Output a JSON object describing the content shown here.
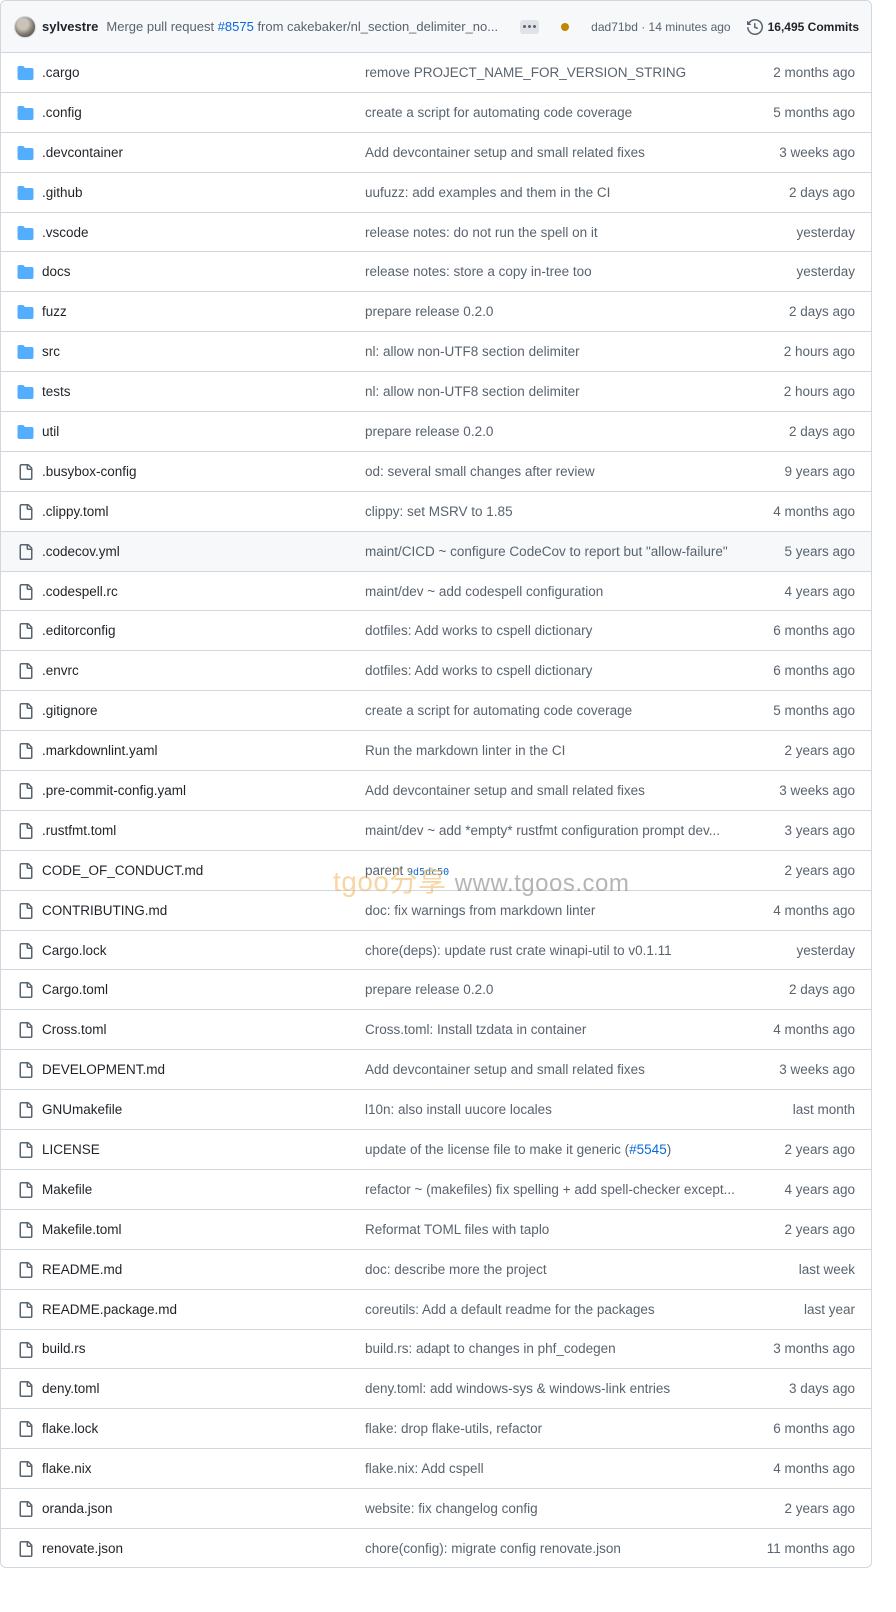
{
  "commit_bar": {
    "author": "sylvestre",
    "message_prefix": "Merge pull request ",
    "message_pr": "#8575",
    "message_suffix": " from cakebaker/nl_section_delimiter_no...",
    "sha_time": "dad71bd · 14 minutes ago",
    "commits": "16,495 Commits",
    "status_color": "#bf8700"
  },
  "files": [
    {
      "type": "folder",
      "name": ".cargo",
      "message": "remove PROJECT_NAME_FOR_VERSION_STRING",
      "date": "2 months ago"
    },
    {
      "type": "folder",
      "name": ".config",
      "message": "create a script for automating code coverage",
      "date": "5 months ago"
    },
    {
      "type": "folder",
      "name": ".devcontainer",
      "message": "Add devcontainer setup and small related fixes",
      "date": "3 weeks ago"
    },
    {
      "type": "folder",
      "name": ".github",
      "message": "uufuzz: add examples and them in the CI",
      "date": "2 days ago"
    },
    {
      "type": "folder",
      "name": ".vscode",
      "message": "release notes: do not run the spell on it",
      "date": "yesterday"
    },
    {
      "type": "folder",
      "name": "docs",
      "message": "release notes: store a copy in-tree too",
      "date": "yesterday"
    },
    {
      "type": "folder",
      "name": "fuzz",
      "message": "prepare release 0.2.0",
      "date": "2 days ago"
    },
    {
      "type": "folder",
      "name": "src",
      "message": "nl: allow non-UTF8 section delimiter",
      "date": "2 hours ago"
    },
    {
      "type": "folder",
      "name": "tests",
      "message": "nl: allow non-UTF8 section delimiter",
      "date": "2 hours ago"
    },
    {
      "type": "folder",
      "name": "util",
      "message": "prepare release 0.2.0",
      "date": "2 days ago"
    },
    {
      "type": "file",
      "name": ".busybox-config",
      "message": "od: several small changes after review",
      "date": "9 years ago"
    },
    {
      "type": "file",
      "name": ".clippy.toml",
      "message": "clippy: set MSRV to 1.85",
      "date": "4 months ago"
    },
    {
      "type": "file",
      "name": ".codecov.yml",
      "message": "maint/CICD ~ configure CodeCov to report but \"allow-failure\"",
      "date": "5 years ago",
      "highlight": true
    },
    {
      "type": "file",
      "name": ".codespell.rc",
      "message": "maint/dev ~ add codespell configuration",
      "date": "4 years ago"
    },
    {
      "type": "file",
      "name": ".editorconfig",
      "message": "dotfiles: Add works to cspell dictionary",
      "date": "6 months ago"
    },
    {
      "type": "file",
      "name": ".envrc",
      "message": "dotfiles: Add works to cspell dictionary",
      "date": "6 months ago"
    },
    {
      "type": "file",
      "name": ".gitignore",
      "message": "create a script for automating code coverage",
      "date": "5 months ago"
    },
    {
      "type": "file",
      "name": ".markdownlint.yaml",
      "message": "Run the markdown linter in the CI",
      "date": "2 years ago"
    },
    {
      "type": "file",
      "name": ".pre-commit-config.yaml",
      "message": "Add devcontainer setup and small related fixes",
      "date": "3 weeks ago"
    },
    {
      "type": "file",
      "name": ".rustfmt.toml",
      "message": "maint/dev ~ add *empty* rustfmt configuration prompt dev...",
      "date": "3 years ago"
    },
    {
      "type": "file",
      "name": "CODE_OF_CONDUCT.md",
      "message": "parent ",
      "message_sha": "9d5dc50",
      "date": "2 years ago"
    },
    {
      "type": "file",
      "name": "CONTRIBUTING.md",
      "message": "doc: fix warnings from markdown linter",
      "date": "4 months ago"
    },
    {
      "type": "file",
      "name": "Cargo.lock",
      "message": "chore(deps): update rust crate winapi-util to v0.1.11",
      "date": "yesterday"
    },
    {
      "type": "file",
      "name": "Cargo.toml",
      "message": "prepare release 0.2.0",
      "date": "2 days ago"
    },
    {
      "type": "file",
      "name": "Cross.toml",
      "message": "Cross.toml: Install tzdata in container",
      "date": "4 months ago"
    },
    {
      "type": "file",
      "name": "DEVELOPMENT.md",
      "message": "Add devcontainer setup and small related fixes",
      "date": "3 weeks ago"
    },
    {
      "type": "file",
      "name": "GNUmakefile",
      "message": "l10n: also install uucore locales",
      "date": "last month"
    },
    {
      "type": "file",
      "name": "LICENSE",
      "message": "update of the license file to make it generic (",
      "message_link": "#5545",
      "message_after": ")",
      "date": "2 years ago"
    },
    {
      "type": "file",
      "name": "Makefile",
      "message": "refactor ~ (makefiles) fix spelling + add spell-checker except...",
      "date": "4 years ago"
    },
    {
      "type": "file",
      "name": "Makefile.toml",
      "message": "Reformat TOML files with taplo",
      "date": "2 years ago"
    },
    {
      "type": "file",
      "name": "README.md",
      "message": "doc: describe more the project",
      "date": "last week"
    },
    {
      "type": "file",
      "name": "README.package.md",
      "message": "coreutils: Add a default readme for the packages",
      "date": "last year"
    },
    {
      "type": "file",
      "name": "build.rs",
      "message": "build.rs: adapt to changes in phf_codegen",
      "date": "3 months ago"
    },
    {
      "type": "file",
      "name": "deny.toml",
      "message": "deny.toml: add windows-sys & windows-link entries",
      "date": "3 days ago"
    },
    {
      "type": "file",
      "name": "flake.lock",
      "message": "flake: drop flake-utils, refactor",
      "date": "6 months ago"
    },
    {
      "type": "file",
      "name": "flake.nix",
      "message": "flake.nix: Add cspell",
      "date": "4 months ago"
    },
    {
      "type": "file",
      "name": "oranda.json",
      "message": "website: fix changelog config",
      "date": "2 years ago"
    },
    {
      "type": "file",
      "name": "renovate.json",
      "message": "chore(config): migrate config renovate.json",
      "date": "11 months ago"
    }
  ],
  "colors": {
    "folder": "#54aeff",
    "file_icon": "#59636e",
    "link": "#0969da"
  },
  "watermark": {
    "brand": "tgoo分享",
    "site": "www.tgoos.com"
  }
}
